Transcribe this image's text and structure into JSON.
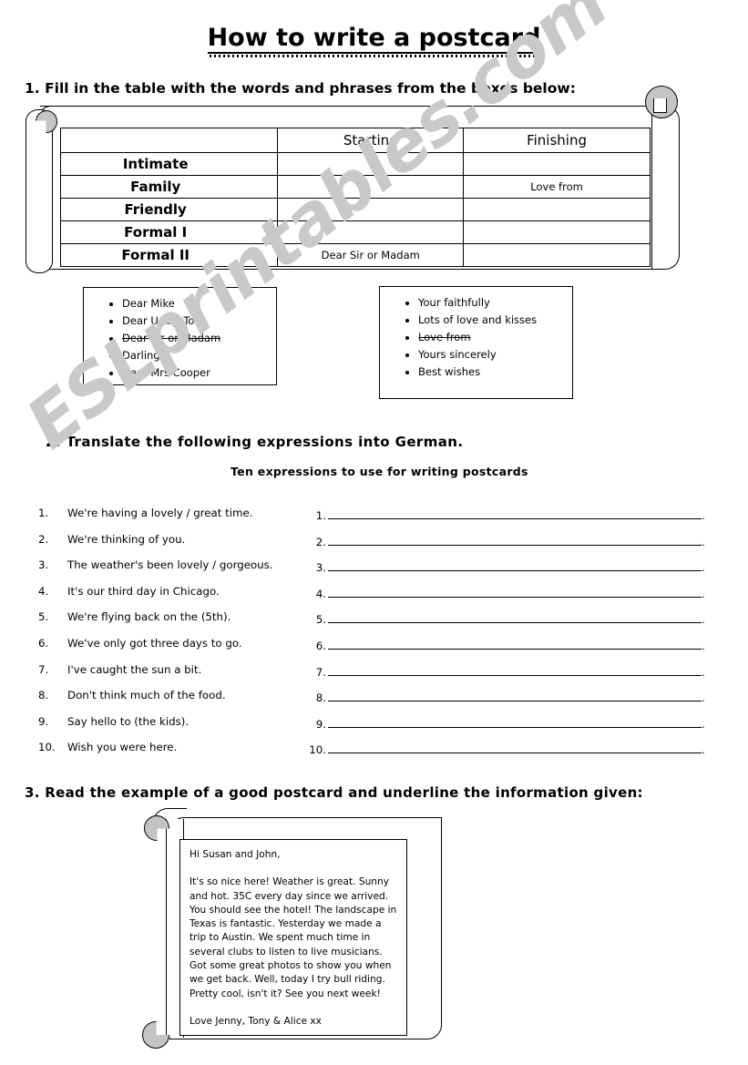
{
  "title": "How to write a postcard",
  "watermark": "ESLprintables.com",
  "task1": {
    "heading": "1. Fill in the table with the words and phrases from the boxes below:",
    "table": {
      "headers": [
        "",
        "Starting",
        "Finishing"
      ],
      "rows": [
        {
          "label": "Intimate ",
          "starting": "",
          "finishing": ""
        },
        {
          "label": "Family ",
          "starting": "",
          "finishing": "Love from"
        },
        {
          "label": "Friendly ",
          "starting": "",
          "finishing": ""
        },
        {
          "label": "Formal I ",
          "starting": "",
          "finishing": ""
        },
        {
          "label": "Formal II ",
          "starting": "Dear Sir or Madam",
          "finishing": ""
        }
      ]
    },
    "box_left": {
      "items": [
        {
          "text": "Dear Mike",
          "struck": false
        },
        {
          "text": "Dear Uncle Tom",
          "struck": false
        },
        {
          "text": "Dear Sir or Madam",
          "struck": true
        },
        {
          "text": "Darling",
          "struck": false
        },
        {
          "text": "Dear Mrs Cooper",
          "struck": false
        }
      ]
    },
    "box_right": {
      "items": [
        {
          "text": "Your faithfully",
          "struck": false
        },
        {
          "text": "Lots of love and kisses",
          "struck": false
        },
        {
          "text": "Love from",
          "struck": true
        },
        {
          "text": "Yours sincerely",
          "struck": false
        },
        {
          "text": "Best wishes",
          "struck": false
        }
      ]
    }
  },
  "task2": {
    "heading": "2. Translate the following expressions into German.",
    "subheading": "Ten expressions to use for writing postcards",
    "expressions": [
      {
        "num": "1.",
        "text": "We're having a lovely / great time."
      },
      {
        "num": "2.",
        "text": "We're thinking of you."
      },
      {
        "num": "3.",
        "text": "The weather's been lovely / gorgeous."
      },
      {
        "num": "4.",
        "text": "It's our third day in Chicago."
      },
      {
        "num": "5.",
        "text": "We're flying back on the (5th)."
      },
      {
        "num": "6.",
        "text": "We've only got three days to go."
      },
      {
        "num": "7.",
        "text": "I've caught the sun a bit."
      },
      {
        "num": "8.",
        "text": "Don't think much of the food."
      },
      {
        "num": "9.",
        "text": "Say hello to (the kids)."
      },
      {
        "num": "10.",
        "text": "Wish you were here."
      }
    ],
    "answers": [
      {
        "num": "1.",
        "value": "",
        "end": "."
      },
      {
        "num": "2.",
        "value": "",
        "end": "."
      },
      {
        "num": "3.",
        "value": "",
        "end": "."
      },
      {
        "num": "4.",
        "value": "",
        "end": "."
      },
      {
        "num": "5.",
        "value": "",
        "end": "."
      },
      {
        "num": "6.",
        "value": "",
        "end": "."
      },
      {
        "num": "7.",
        "value": "",
        "end": "."
      },
      {
        "num": "8.",
        "value": "",
        "end": "."
      },
      {
        "num": "9.",
        "value": "",
        "end": "."
      },
      {
        "num": "10.",
        "value": "",
        "end": "."
      }
    ]
  },
  "task3": {
    "heading": "3. Read the example of a good postcard and underline the information given:",
    "postcard": {
      "greeting": "Hi Susan and John,",
      "body": "It's so nice here! Weather is great. Sunny and hot. 35C every day since we arrived. You should see the hotel! The landscape in Texas is fantastic. Yesterday we made a trip to Austin. We spent much time in several clubs to listen to live musicians. Got some great photos to show you when we get back. Well, today I try bull riding. Pretty cool, isn't it? See you next week!",
      "signoff": "Love Jenny, Tony & Alice xx"
    }
  }
}
